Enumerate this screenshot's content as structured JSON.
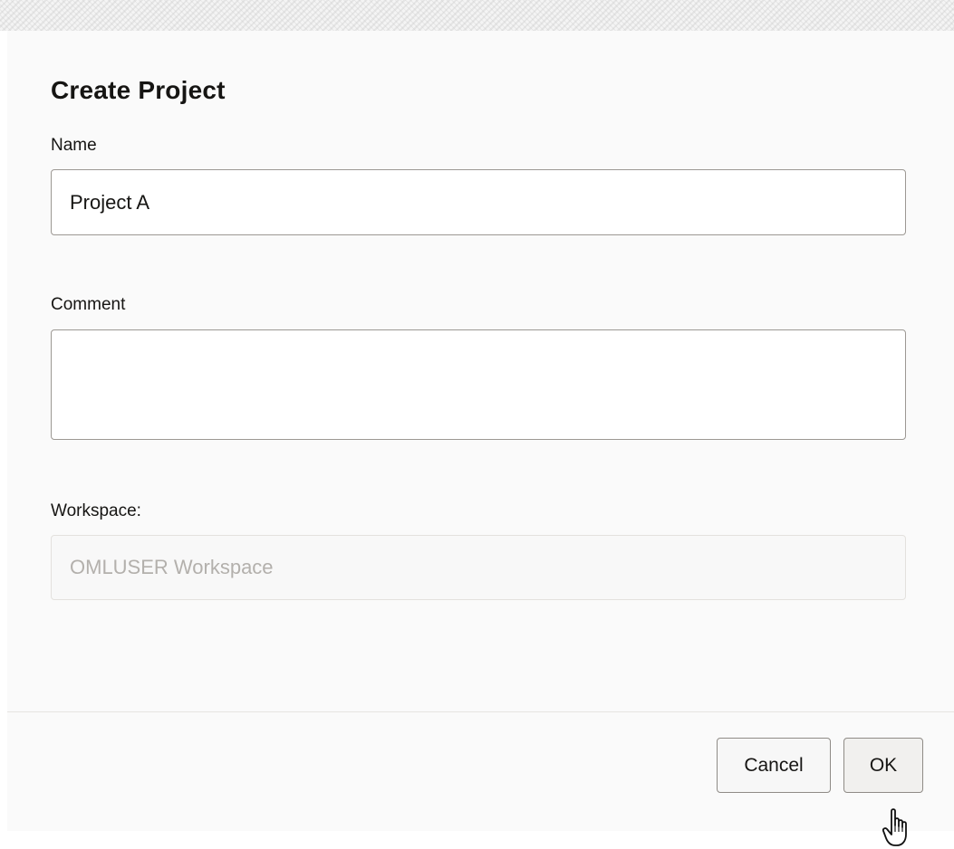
{
  "dialog": {
    "title": "Create Project",
    "fields": {
      "name": {
        "label": "Name",
        "value": "Project A"
      },
      "comment": {
        "label": "Comment",
        "value": ""
      },
      "workspace": {
        "label": "Workspace:",
        "value": "OMLUSER Workspace"
      }
    },
    "buttons": {
      "cancel": "Cancel",
      "ok": "OK"
    }
  },
  "icons": {
    "cursor": "hand-pointer-icon"
  }
}
